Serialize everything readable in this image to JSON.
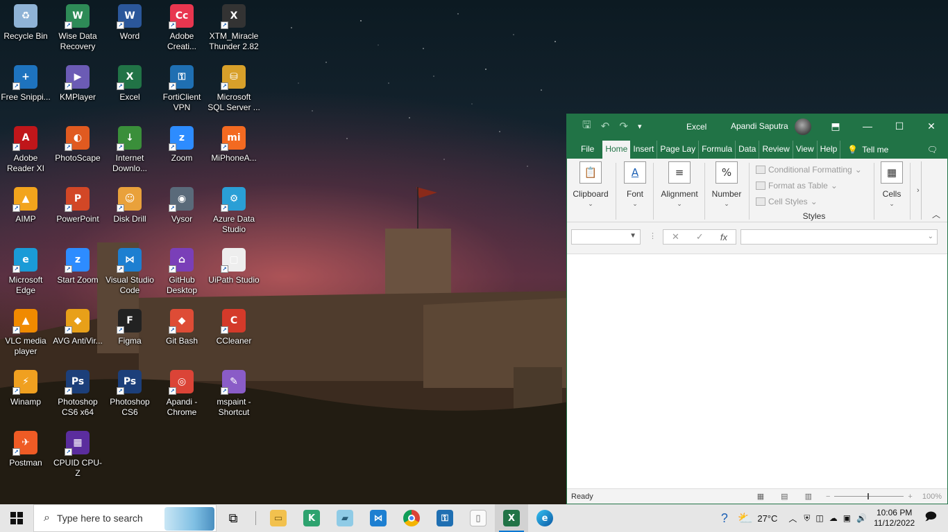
{
  "desktop": {
    "icons": [
      {
        "label": "Recycle Bin",
        "icon": "recycle-bin-icon",
        "color": "#8fb3d6",
        "glyph": "♻"
      },
      {
        "label": "Wise Data Recovery",
        "icon": "wise-data-recovery-icon",
        "color": "#2e8b57",
        "glyph": "W"
      },
      {
        "label": "Word",
        "icon": "word-icon",
        "color": "#2b579a",
        "glyph": "W"
      },
      {
        "label": "Adobe Creati...",
        "icon": "adobe-creative-cloud-icon",
        "color": "#e8364f",
        "glyph": "Cc"
      },
      {
        "label": "XTM_Miracle Thunder 2.82",
        "icon": "xtm-miracle-icon",
        "color": "#333333",
        "glyph": "X"
      },
      {
        "label": "Free Snippi...",
        "icon": "free-snipping-icon",
        "color": "#1e73be",
        "glyph": "+"
      },
      {
        "label": "KMPlayer",
        "icon": "kmplayer-icon",
        "color": "#6b5bb5",
        "glyph": "▶"
      },
      {
        "label": "Excel",
        "icon": "excel-icon",
        "color": "#217346",
        "glyph": "X"
      },
      {
        "label": "FortiClient VPN",
        "icon": "forticlient-icon",
        "color": "#1f6fb2",
        "glyph": "⚿"
      },
      {
        "label": "Microsoft SQL Server ...",
        "icon": "sql-server-icon",
        "color": "#d8a02a",
        "glyph": "⛁"
      },
      {
        "label": "Adobe Reader XI",
        "icon": "adobe-reader-icon",
        "color": "#c0161a",
        "glyph": "A"
      },
      {
        "label": "PhotoScape",
        "icon": "photoscape-icon",
        "color": "#e05a20",
        "glyph": "◐"
      },
      {
        "label": "Internet Downlo...",
        "icon": "idm-icon",
        "color": "#3a8f3a",
        "glyph": "↓"
      },
      {
        "label": "Zoom",
        "icon": "zoom-icon",
        "color": "#2d8cff",
        "glyph": "z"
      },
      {
        "label": "MiPhoneA...",
        "icon": "miphone-icon",
        "color": "#f36a21",
        "glyph": "mi"
      },
      {
        "label": "AIMP",
        "icon": "aimp-icon",
        "color": "#f2a41c",
        "glyph": "▲"
      },
      {
        "label": "PowerPoint",
        "icon": "powerpoint-icon",
        "color": "#d24726",
        "glyph": "P"
      },
      {
        "label": "Disk Drill",
        "icon": "disk-drill-icon",
        "color": "#e9a13b",
        "glyph": "☺"
      },
      {
        "label": "Vysor",
        "icon": "vysor-icon",
        "color": "#5a6a7a",
        "glyph": "◉"
      },
      {
        "label": "Azure Data Studio",
        "icon": "azure-data-studio-icon",
        "color": "#2a9fd6",
        "glyph": "⚙"
      },
      {
        "label": "Microsoft Edge",
        "icon": "edge-icon",
        "color": "#1a9bd7",
        "glyph": "e"
      },
      {
        "label": "Start Zoom",
        "icon": "start-zoom-icon",
        "color": "#2d8cff",
        "glyph": "z"
      },
      {
        "label": "Visual Studio Code",
        "icon": "vscode-icon",
        "color": "#1d7fd1",
        "glyph": "⋈"
      },
      {
        "label": "GitHub Desktop",
        "icon": "github-desktop-icon",
        "color": "#7a3fb8",
        "glyph": "⌂"
      },
      {
        "label": "UiPath Studio",
        "icon": "uipath-icon",
        "color": "#eeeeee",
        "glyph": "▢"
      },
      {
        "label": "VLC media player",
        "icon": "vlc-icon",
        "color": "#f08a00",
        "glyph": "▲"
      },
      {
        "label": "AVG AntiVir...",
        "icon": "avg-icon",
        "color": "#e8a019",
        "glyph": "◆"
      },
      {
        "label": "Figma",
        "icon": "figma-icon",
        "color": "#222222",
        "glyph": "F"
      },
      {
        "label": "Git Bash",
        "icon": "git-bash-icon",
        "color": "#de4c36",
        "glyph": "◆"
      },
      {
        "label": "CCleaner",
        "icon": "ccleaner-icon",
        "color": "#d43a2a",
        "glyph": "C"
      },
      {
        "label": "Winamp",
        "icon": "winamp-icon",
        "color": "#f0a020",
        "glyph": "⚡"
      },
      {
        "label": "Photoshop CS6 x64",
        "icon": "photoshop-icon",
        "color": "#1c3f7a",
        "glyph": "Ps"
      },
      {
        "label": "Photoshop CS6",
        "icon": "photoshop-icon",
        "color": "#1c3f7a",
        "glyph": "Ps"
      },
      {
        "label": "Apandi - Chrome",
        "icon": "chrome-icon",
        "color": "#db4437",
        "glyph": "◎"
      },
      {
        "label": "mspaint - Shortcut",
        "icon": "mspaint-icon",
        "color": "#8a5cc7",
        "glyph": "✎"
      },
      {
        "label": "Postman",
        "icon": "postman-icon",
        "color": "#ef5b25",
        "glyph": "✈"
      },
      {
        "label": "CPUID CPU-Z",
        "icon": "cpuz-icon",
        "color": "#5b2d9e",
        "glyph": "▦"
      }
    ]
  },
  "excel": {
    "app_name": "Excel",
    "user": "Apandi Saputra",
    "tabs": [
      "File",
      "Home",
      "Insert",
      "Page Lay",
      "Formula",
      "Data",
      "Review",
      "View",
      "Help"
    ],
    "active_tab": "Home",
    "tell_me": "Tell me",
    "ribbon": {
      "clipboard": "Clipboard",
      "font": "Font",
      "alignment": "Alignment",
      "number": "Number",
      "conditional_formatting": "Conditional Formatting",
      "format_as_table": "Format as Table",
      "cell_styles": "Cell Styles",
      "styles": "Styles",
      "cells": "Cells"
    },
    "status": "Ready",
    "zoom": "100%",
    "brand_color": "#217346"
  },
  "taskbar": {
    "search_placeholder": "Type here to search",
    "weather": "27°C",
    "time": "10:06 PM",
    "date": "11/12/2022"
  }
}
